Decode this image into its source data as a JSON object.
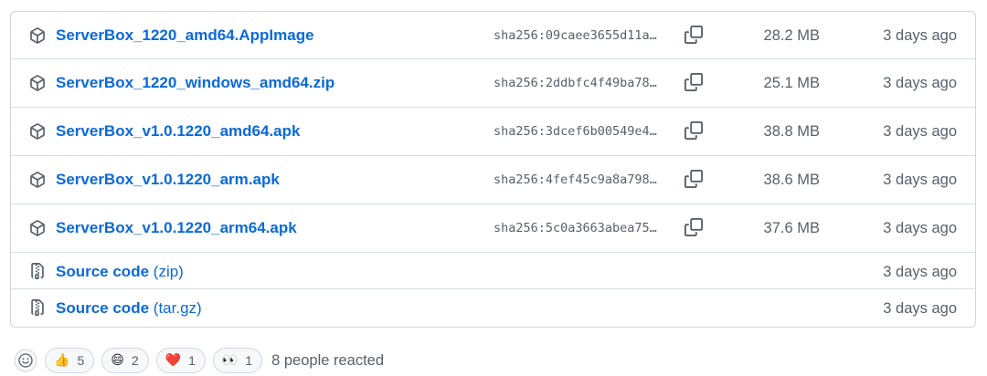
{
  "assets": [
    {
      "name": "ServerBox_1220_amd64.AppImage",
      "sha": "sha256:09caee3655d11a…",
      "size": "28.2 MB",
      "date": "3 days ago"
    },
    {
      "name": "ServerBox_1220_windows_amd64.zip",
      "sha": "sha256:2ddbfc4f49ba78…",
      "size": "25.1 MB",
      "date": "3 days ago"
    },
    {
      "name": "ServerBox_v1.0.1220_amd64.apk",
      "sha": "sha256:3dcef6b00549e4…",
      "size": "38.8 MB",
      "date": "3 days ago"
    },
    {
      "name": "ServerBox_v1.0.1220_arm.apk",
      "sha": "sha256:4fef45c9a8a798…",
      "size": "38.6 MB",
      "date": "3 days ago"
    },
    {
      "name": "ServerBox_v1.0.1220_arm64.apk",
      "sha": "sha256:5c0a3663abea75…",
      "size": "37.6 MB",
      "date": "3 days ago"
    }
  ],
  "sources": [
    {
      "name": "Source code",
      "suffix": "(zip)",
      "date": "3 days ago"
    },
    {
      "name": "Source code",
      "suffix": "(tar.gz)",
      "date": "3 days ago"
    }
  ],
  "reactions": {
    "items": [
      {
        "emoji": "👍",
        "count": "5"
      },
      {
        "emoji": "😄",
        "count": "2"
      },
      {
        "emoji": "❤️",
        "count": "1"
      },
      {
        "emoji": "👀",
        "count": "1"
      }
    ],
    "summary": "8 people reacted"
  },
  "icons": {
    "package": "package-icon",
    "copy": "copy-icon",
    "zip": "file-zip-icon",
    "smiley": "smiley-icon"
  },
  "colors": {
    "link": "#0969da",
    "muted": "#57606a",
    "border": "#d0d7de"
  }
}
